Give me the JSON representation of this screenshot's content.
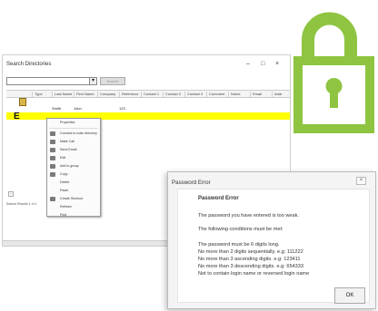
{
  "search_window": {
    "title": "Search Directories",
    "window_controls": [
      "–",
      "□",
      "×"
    ],
    "search": {
      "value": "",
      "button_label": "Search"
    },
    "columns": [
      "Type",
      "Last Name",
      "First Name",
      "Company",
      "Reference",
      "Contact 1",
      "Contact 2",
      "Contact 3",
      "Comment",
      "Notes",
      "Email",
      "Addr"
    ],
    "rows": [
      {
        "type": "",
        "last": "Smith",
        "first": "John",
        "extra": "123"
      },
      {
        "type": "E",
        "last": "",
        "first": "",
        "extra": ""
      }
    ],
    "context_menu": [
      "Properties",
      "Connect to main directory",
      "Make Call",
      "Send Email",
      "Edit",
      "Add to group",
      "Copy",
      "Delete",
      "Paste",
      "Create Shortcut",
      "Refresh",
      "Find"
    ],
    "left_status": "Search Results 1 of 1"
  },
  "dialog": {
    "title": "Password Error",
    "close_glyph": "×",
    "heading": "Password Error",
    "lines": [
      "The password you have entered is too weak.",
      "The following conditions must be met:",
      "The password must be 6 digits long.",
      "No more than 2 digits sequentially.  e.g: 111222",
      "No more than 3 ascending digits.  e.g: 123411",
      "No more than 3 descending digits.  e.g: 654333",
      "Not to contain login name or reversed login name"
    ],
    "ok_label": "OK"
  },
  "colors": {
    "lock_green": "#8ec440",
    "highlight": "#ffff00"
  }
}
